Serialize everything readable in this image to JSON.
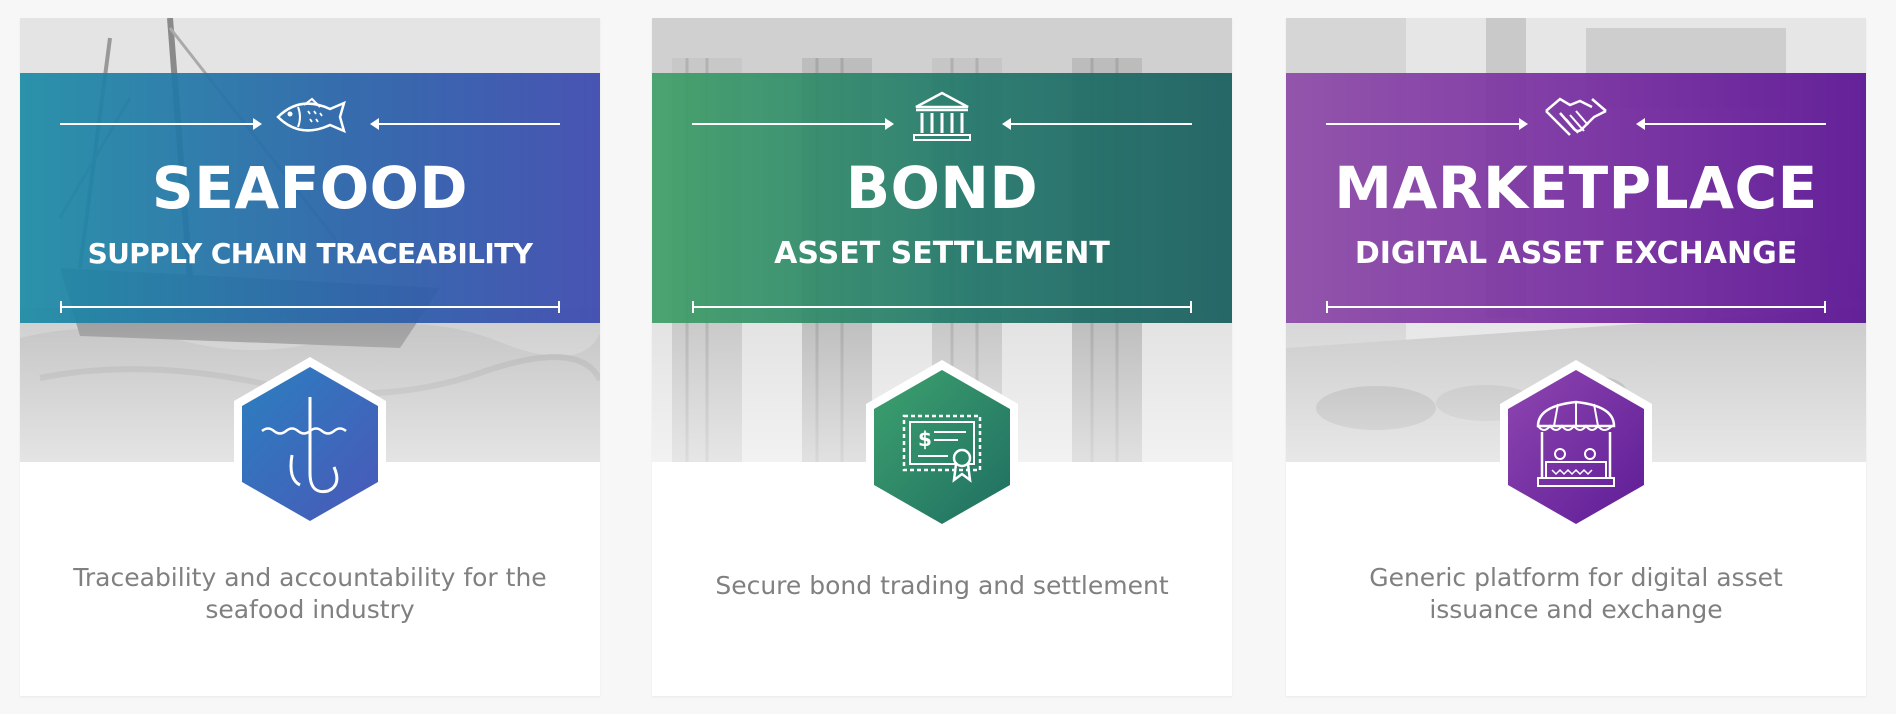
{
  "cards": [
    {
      "title": "SEAFOOD",
      "subtitle": "SUPPLY CHAIN TRACEABILITY",
      "description_lines": [
        "Traceability and accountability for the",
        "seafood industry"
      ],
      "banner_icon": "fish-icon",
      "hex_icon": "fishing-hook-icon",
      "colors": {
        "from": "#1b8ba5",
        "to": "#404cb0"
      }
    },
    {
      "title": "BOND",
      "subtitle": "ASSET SETTLEMENT",
      "description_lines": [
        "Secure bond trading and settlement"
      ],
      "banner_icon": "bank-building-icon",
      "hex_icon": "bond-certificate-icon",
      "colors": {
        "from": "#40a068",
        "to": "#1c6060"
      }
    },
    {
      "title": "MARKETPLACE",
      "subtitle": "DIGITAL ASSET EXCHANGE",
      "description_lines": [
        "Generic platform for digital asset",
        "issuance and exchange"
      ],
      "banner_icon": "handshake-icon",
      "hex_icon": "market-stall-icon",
      "colors": {
        "from": "#8d4aa8",
        "to": "#5f1a96"
      }
    }
  ]
}
